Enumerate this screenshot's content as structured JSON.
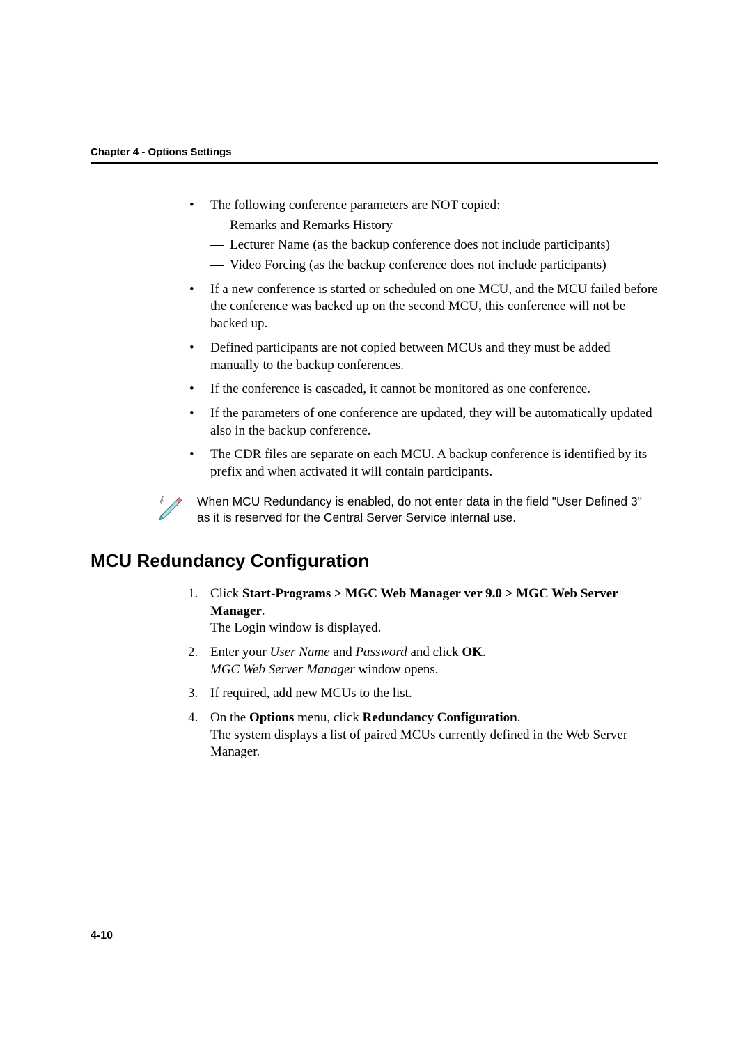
{
  "header": "Chapter 4 - Options Settings",
  "bullets": {
    "b1": "The following conference parameters are NOT copied:",
    "b1_sub1": "Remarks and Remarks History",
    "b1_sub2": "Lecturer Name (as the backup conference does not include participants)",
    "b1_sub3": "Video Forcing (as the backup conference does not include participants)",
    "b2": "If a new conference is started or scheduled on one MCU, and the MCU failed before the conference was backed up on the second MCU, this conference will not be backed up.",
    "b3": "Defined participants are not copied between MCUs and they must be added manually to the backup conferences.",
    "b4": "If the conference is cascaded, it cannot be monitored as one conference.",
    "b5": "If the parameters of one conference are updated, they will be automatically updated also in the backup conference.",
    "b6": "The CDR files are separate on each MCU. A backup conference is identified by its prefix and when activated it will contain participants."
  },
  "note": "When MCU Redundancy is enabled, do not enter data in the field \"User Defined 3\" as it is reserved for the Central Server Service internal use.",
  "section_heading": "MCU Redundancy Configuration",
  "steps": {
    "s1_pre": "Click ",
    "s1_bold": "Start-Programs > MGC Web Manager ver 9.0 > MGC Web Server Manager",
    "s1_post": ".",
    "s1_line2": "The Login window is displayed.",
    "s2_pre": "Enter your ",
    "s2_i1": "User Name",
    "s2_mid": " and ",
    "s2_i2": "Password",
    "s2_mid2": " and click ",
    "s2_bold": "OK",
    "s2_post": ".",
    "s2_line2_i": "MGC Web Server Manager",
    "s2_line2_post": " window opens.",
    "s3": "If required, add new MCUs to the list.",
    "s4_pre": "On the ",
    "s4_b1": "Options",
    "s4_mid": " menu, click ",
    "s4_b2": "Redundancy Configuration",
    "s4_post": ".",
    "s4_line2": "The system displays a list of paired MCUs currently defined in the Web Server Manager."
  },
  "page_number": "4-10"
}
